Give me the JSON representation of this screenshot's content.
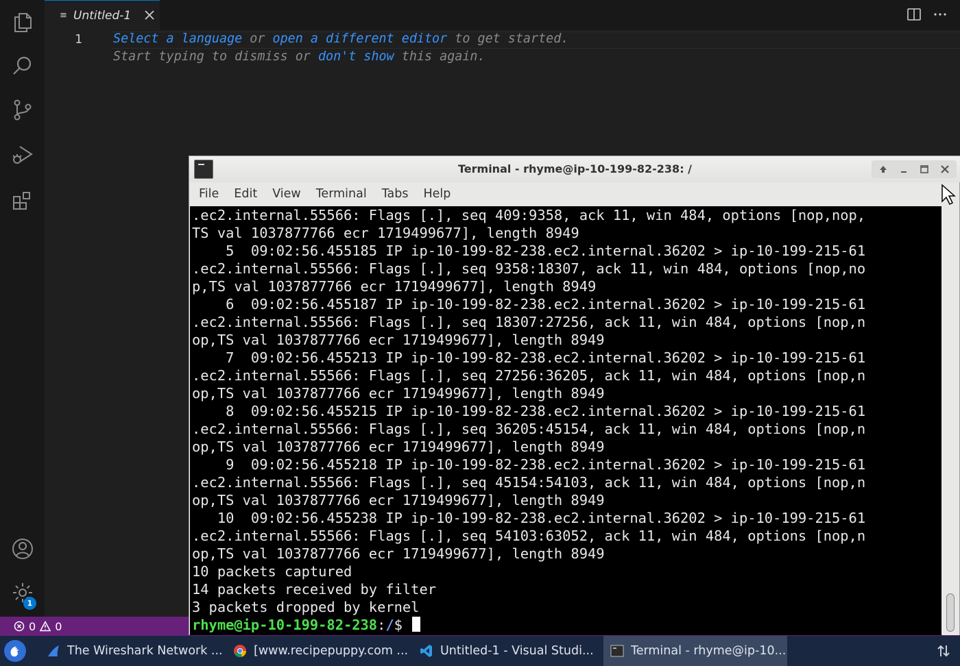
{
  "vscode": {
    "activity_bar": [
      {
        "name": "explorer",
        "icon": "files-icon"
      },
      {
        "name": "search",
        "icon": "search-icon"
      },
      {
        "name": "source-control",
        "icon": "source-control-icon"
      },
      {
        "name": "run-debug",
        "icon": "run-debug-icon"
      },
      {
        "name": "extensions",
        "icon": "extensions-icon"
      }
    ],
    "accounts_icon": "account-icon",
    "settings_icon": "gear-icon",
    "settings_badge": "1",
    "tab": {
      "label": "Untitled-1"
    },
    "editor": {
      "line_number": "1",
      "hint_line1": {
        "link1": "Select a language",
        "mid": " or ",
        "link2": "open a different editor",
        "tail": " to get started."
      },
      "hint_line2": {
        "head": "Start typing to dismiss or ",
        "link": "don't show",
        "tail": " this again."
      }
    },
    "status": {
      "errors": "0",
      "warnings": "0"
    },
    "colors": {
      "accent": "#0078d4",
      "statusbar": "#68217a",
      "link": "#3794ff"
    }
  },
  "terminal": {
    "title": "Terminal - rhyme@ip-10-199-82-238: /",
    "menu": [
      "File",
      "Edit",
      "View",
      "Terminal",
      "Tabs",
      "Help"
    ],
    "lines": [
      ".ec2.internal.55566: Flags [.], seq 409:9358, ack 11, win 484, options [nop,nop,",
      "TS val 1037877766 ecr 1719499677], length 8949",
      "    5  09:02:56.455185 IP ip-10-199-82-238.ec2.internal.36202 > ip-10-199-215-61",
      ".ec2.internal.55566: Flags [.], seq 9358:18307, ack 11, win 484, options [nop,no",
      "p,TS val 1037877766 ecr 1719499677], length 8949",
      "    6  09:02:56.455187 IP ip-10-199-82-238.ec2.internal.36202 > ip-10-199-215-61",
      ".ec2.internal.55566: Flags [.], seq 18307:27256, ack 11, win 484, options [nop,n",
      "op,TS val 1037877766 ecr 1719499677], length 8949",
      "    7  09:02:56.455213 IP ip-10-199-82-238.ec2.internal.36202 > ip-10-199-215-61",
      ".ec2.internal.55566: Flags [.], seq 27256:36205, ack 11, win 484, options [nop,n",
      "op,TS val 1037877766 ecr 1719499677], length 8949",
      "    8  09:02:56.455215 IP ip-10-199-82-238.ec2.internal.36202 > ip-10-199-215-61",
      ".ec2.internal.55566: Flags [.], seq 36205:45154, ack 11, win 484, options [nop,n",
      "op,TS val 1037877766 ecr 1719499677], length 8949",
      "    9  09:02:56.455218 IP ip-10-199-82-238.ec2.internal.36202 > ip-10-199-215-61",
      ".ec2.internal.55566: Flags [.], seq 45154:54103, ack 11, win 484, options [nop,n",
      "op,TS val 1037877766 ecr 1719499677], length 8949",
      "   10  09:02:56.455238 IP ip-10-199-82-238.ec2.internal.36202 > ip-10-199-215-61",
      ".ec2.internal.55566: Flags [.], seq 54103:63052, ack 11, win 484, options [nop,n",
      "op,TS val 1037877766 ecr 1719499677], length 8949",
      "10 packets captured",
      "14 packets received by filter",
      "3 packets dropped by kernel"
    ],
    "prompt": {
      "user_host": "rhyme@ip-10-199-82-238",
      "sep": ":",
      "path": "/",
      "symbol": "$ "
    },
    "colors": {
      "prompt_user": "#4de04d",
      "prompt_path": "#6f9bff"
    }
  },
  "taskbar": {
    "items": [
      {
        "label": "The Wireshark Network ...",
        "icon": "wireshark-fin-icon"
      },
      {
        "label": "[www.recipepuppy.com ...",
        "icon": "chrome-icon"
      },
      {
        "label": "Untitled-1 - Visual Studi...",
        "icon": "vscode-icon"
      },
      {
        "label": "Terminal - rhyme@ip-10...",
        "icon": "terminal-icon"
      }
    ],
    "tray_icon": "network-arrows-icon"
  }
}
